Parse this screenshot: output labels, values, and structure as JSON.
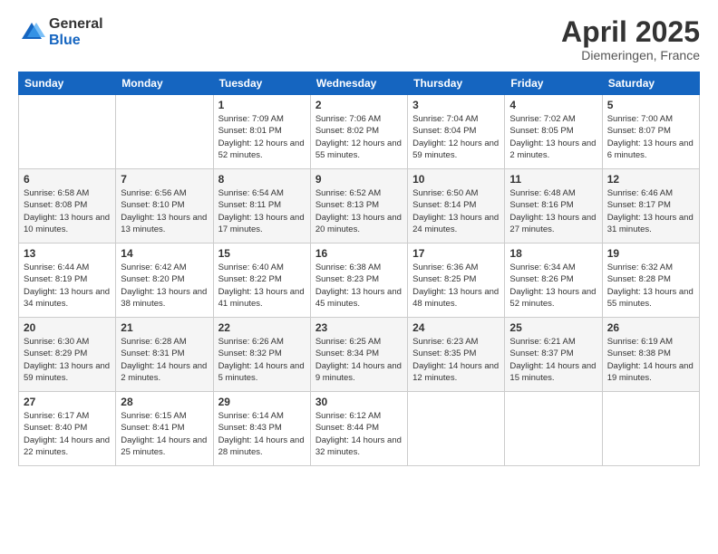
{
  "logo": {
    "general": "General",
    "blue": "Blue"
  },
  "header": {
    "title": "April 2025",
    "location": "Diemeringen, France"
  },
  "weekdays": [
    "Sunday",
    "Monday",
    "Tuesday",
    "Wednesday",
    "Thursday",
    "Friday",
    "Saturday"
  ],
  "weeks": [
    [
      {
        "day": "",
        "sunrise": "",
        "sunset": "",
        "daylight": ""
      },
      {
        "day": "",
        "sunrise": "",
        "sunset": "",
        "daylight": ""
      },
      {
        "day": "1",
        "sunrise": "Sunrise: 7:09 AM",
        "sunset": "Sunset: 8:01 PM",
        "daylight": "Daylight: 12 hours and 52 minutes."
      },
      {
        "day": "2",
        "sunrise": "Sunrise: 7:06 AM",
        "sunset": "Sunset: 8:02 PM",
        "daylight": "Daylight: 12 hours and 55 minutes."
      },
      {
        "day": "3",
        "sunrise": "Sunrise: 7:04 AM",
        "sunset": "Sunset: 8:04 PM",
        "daylight": "Daylight: 12 hours and 59 minutes."
      },
      {
        "day": "4",
        "sunrise": "Sunrise: 7:02 AM",
        "sunset": "Sunset: 8:05 PM",
        "daylight": "Daylight: 13 hours and 2 minutes."
      },
      {
        "day": "5",
        "sunrise": "Sunrise: 7:00 AM",
        "sunset": "Sunset: 8:07 PM",
        "daylight": "Daylight: 13 hours and 6 minutes."
      }
    ],
    [
      {
        "day": "6",
        "sunrise": "Sunrise: 6:58 AM",
        "sunset": "Sunset: 8:08 PM",
        "daylight": "Daylight: 13 hours and 10 minutes."
      },
      {
        "day": "7",
        "sunrise": "Sunrise: 6:56 AM",
        "sunset": "Sunset: 8:10 PM",
        "daylight": "Daylight: 13 hours and 13 minutes."
      },
      {
        "day": "8",
        "sunrise": "Sunrise: 6:54 AM",
        "sunset": "Sunset: 8:11 PM",
        "daylight": "Daylight: 13 hours and 17 minutes."
      },
      {
        "day": "9",
        "sunrise": "Sunrise: 6:52 AM",
        "sunset": "Sunset: 8:13 PM",
        "daylight": "Daylight: 13 hours and 20 minutes."
      },
      {
        "day": "10",
        "sunrise": "Sunrise: 6:50 AM",
        "sunset": "Sunset: 8:14 PM",
        "daylight": "Daylight: 13 hours and 24 minutes."
      },
      {
        "day": "11",
        "sunrise": "Sunrise: 6:48 AM",
        "sunset": "Sunset: 8:16 PM",
        "daylight": "Daylight: 13 hours and 27 minutes."
      },
      {
        "day": "12",
        "sunrise": "Sunrise: 6:46 AM",
        "sunset": "Sunset: 8:17 PM",
        "daylight": "Daylight: 13 hours and 31 minutes."
      }
    ],
    [
      {
        "day": "13",
        "sunrise": "Sunrise: 6:44 AM",
        "sunset": "Sunset: 8:19 PM",
        "daylight": "Daylight: 13 hours and 34 minutes."
      },
      {
        "day": "14",
        "sunrise": "Sunrise: 6:42 AM",
        "sunset": "Sunset: 8:20 PM",
        "daylight": "Daylight: 13 hours and 38 minutes."
      },
      {
        "day": "15",
        "sunrise": "Sunrise: 6:40 AM",
        "sunset": "Sunset: 8:22 PM",
        "daylight": "Daylight: 13 hours and 41 minutes."
      },
      {
        "day": "16",
        "sunrise": "Sunrise: 6:38 AM",
        "sunset": "Sunset: 8:23 PM",
        "daylight": "Daylight: 13 hours and 45 minutes."
      },
      {
        "day": "17",
        "sunrise": "Sunrise: 6:36 AM",
        "sunset": "Sunset: 8:25 PM",
        "daylight": "Daylight: 13 hours and 48 minutes."
      },
      {
        "day": "18",
        "sunrise": "Sunrise: 6:34 AM",
        "sunset": "Sunset: 8:26 PM",
        "daylight": "Daylight: 13 hours and 52 minutes."
      },
      {
        "day": "19",
        "sunrise": "Sunrise: 6:32 AM",
        "sunset": "Sunset: 8:28 PM",
        "daylight": "Daylight: 13 hours and 55 minutes."
      }
    ],
    [
      {
        "day": "20",
        "sunrise": "Sunrise: 6:30 AM",
        "sunset": "Sunset: 8:29 PM",
        "daylight": "Daylight: 13 hours and 59 minutes."
      },
      {
        "day": "21",
        "sunrise": "Sunrise: 6:28 AM",
        "sunset": "Sunset: 8:31 PM",
        "daylight": "Daylight: 14 hours and 2 minutes."
      },
      {
        "day": "22",
        "sunrise": "Sunrise: 6:26 AM",
        "sunset": "Sunset: 8:32 PM",
        "daylight": "Daylight: 14 hours and 5 minutes."
      },
      {
        "day": "23",
        "sunrise": "Sunrise: 6:25 AM",
        "sunset": "Sunset: 8:34 PM",
        "daylight": "Daylight: 14 hours and 9 minutes."
      },
      {
        "day": "24",
        "sunrise": "Sunrise: 6:23 AM",
        "sunset": "Sunset: 8:35 PM",
        "daylight": "Daylight: 14 hours and 12 minutes."
      },
      {
        "day": "25",
        "sunrise": "Sunrise: 6:21 AM",
        "sunset": "Sunset: 8:37 PM",
        "daylight": "Daylight: 14 hours and 15 minutes."
      },
      {
        "day": "26",
        "sunrise": "Sunrise: 6:19 AM",
        "sunset": "Sunset: 8:38 PM",
        "daylight": "Daylight: 14 hours and 19 minutes."
      }
    ],
    [
      {
        "day": "27",
        "sunrise": "Sunrise: 6:17 AM",
        "sunset": "Sunset: 8:40 PM",
        "daylight": "Daylight: 14 hours and 22 minutes."
      },
      {
        "day": "28",
        "sunrise": "Sunrise: 6:15 AM",
        "sunset": "Sunset: 8:41 PM",
        "daylight": "Daylight: 14 hours and 25 minutes."
      },
      {
        "day": "29",
        "sunrise": "Sunrise: 6:14 AM",
        "sunset": "Sunset: 8:43 PM",
        "daylight": "Daylight: 14 hours and 28 minutes."
      },
      {
        "day": "30",
        "sunrise": "Sunrise: 6:12 AM",
        "sunset": "Sunset: 8:44 PM",
        "daylight": "Daylight: 14 hours and 32 minutes."
      },
      {
        "day": "",
        "sunrise": "",
        "sunset": "",
        "daylight": ""
      },
      {
        "day": "",
        "sunrise": "",
        "sunset": "",
        "daylight": ""
      },
      {
        "day": "",
        "sunrise": "",
        "sunset": "",
        "daylight": ""
      }
    ]
  ]
}
